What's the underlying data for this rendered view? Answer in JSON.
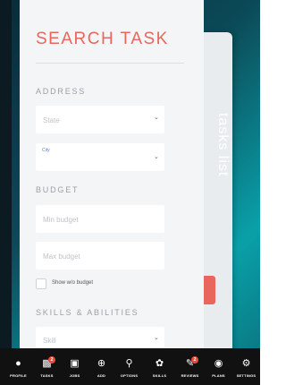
{
  "panel": {
    "title": "SEARCH TASK",
    "address_heading": "ADDRESS",
    "state_placeholder": "State",
    "city_label": "City",
    "budget_heading": "BUDGET",
    "min_budget_placeholder": "Min budget",
    "max_budget_placeholder": "Max budget",
    "show_wo_budget": "Show w/o budget",
    "skills_heading": "SKILLS & ABILITIES",
    "skill_placeholder": "Skill"
  },
  "side_tab": {
    "label": "tasks list"
  },
  "nav": {
    "items": [
      {
        "label": "PROFILE",
        "icon": "person-icon"
      },
      {
        "label": "TASKS",
        "icon": "clipboard-icon",
        "badge": "2"
      },
      {
        "label": "JOBS",
        "icon": "briefcase-icon"
      },
      {
        "label": "ADD",
        "icon": "plus-circle-icon"
      },
      {
        "label": "OPTIONS",
        "icon": "search-gear-icon"
      },
      {
        "label": "SKILLS",
        "icon": "skills-icon"
      },
      {
        "label": "REVIEWS",
        "icon": "reviews-icon",
        "badge": "2"
      },
      {
        "label": "PLANS",
        "icon": "money-bag-icon"
      },
      {
        "label": "SETTINGS",
        "icon": "gear-icon"
      }
    ]
  },
  "colors": {
    "accent": "#e8665c",
    "nav_bg": "#111111",
    "badge": "#e74c3c"
  }
}
